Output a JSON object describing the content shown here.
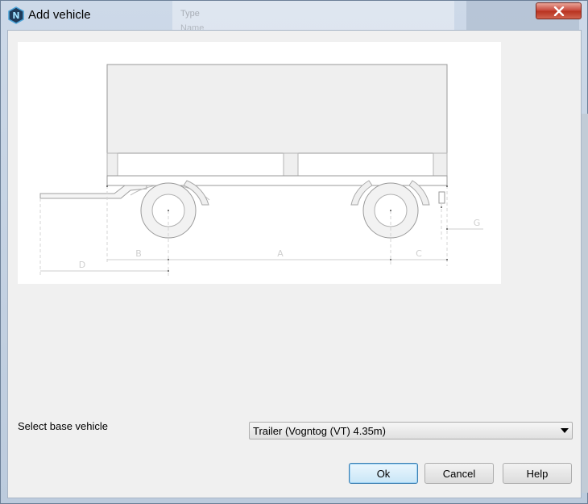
{
  "window": {
    "title": "Add vehicle",
    "background_hint_1": "Type",
    "background_hint_2": "Name"
  },
  "drawing": {
    "labels": {
      "a": "A",
      "b": "B",
      "c": "C",
      "d": "D",
      "g": "G"
    }
  },
  "form": {
    "base_vehicle_label": "Select base vehicle",
    "base_vehicle_value": "Trailer (Vogntog (VT) 4.35m)"
  },
  "buttons": {
    "ok": "Ok",
    "cancel": "Cancel",
    "help": "Help"
  },
  "colors": {
    "accent": "#3c7fb1",
    "close": "#c7473a",
    "drawing_line": "#b8b8b8",
    "drawing_fill": "#efefef"
  }
}
